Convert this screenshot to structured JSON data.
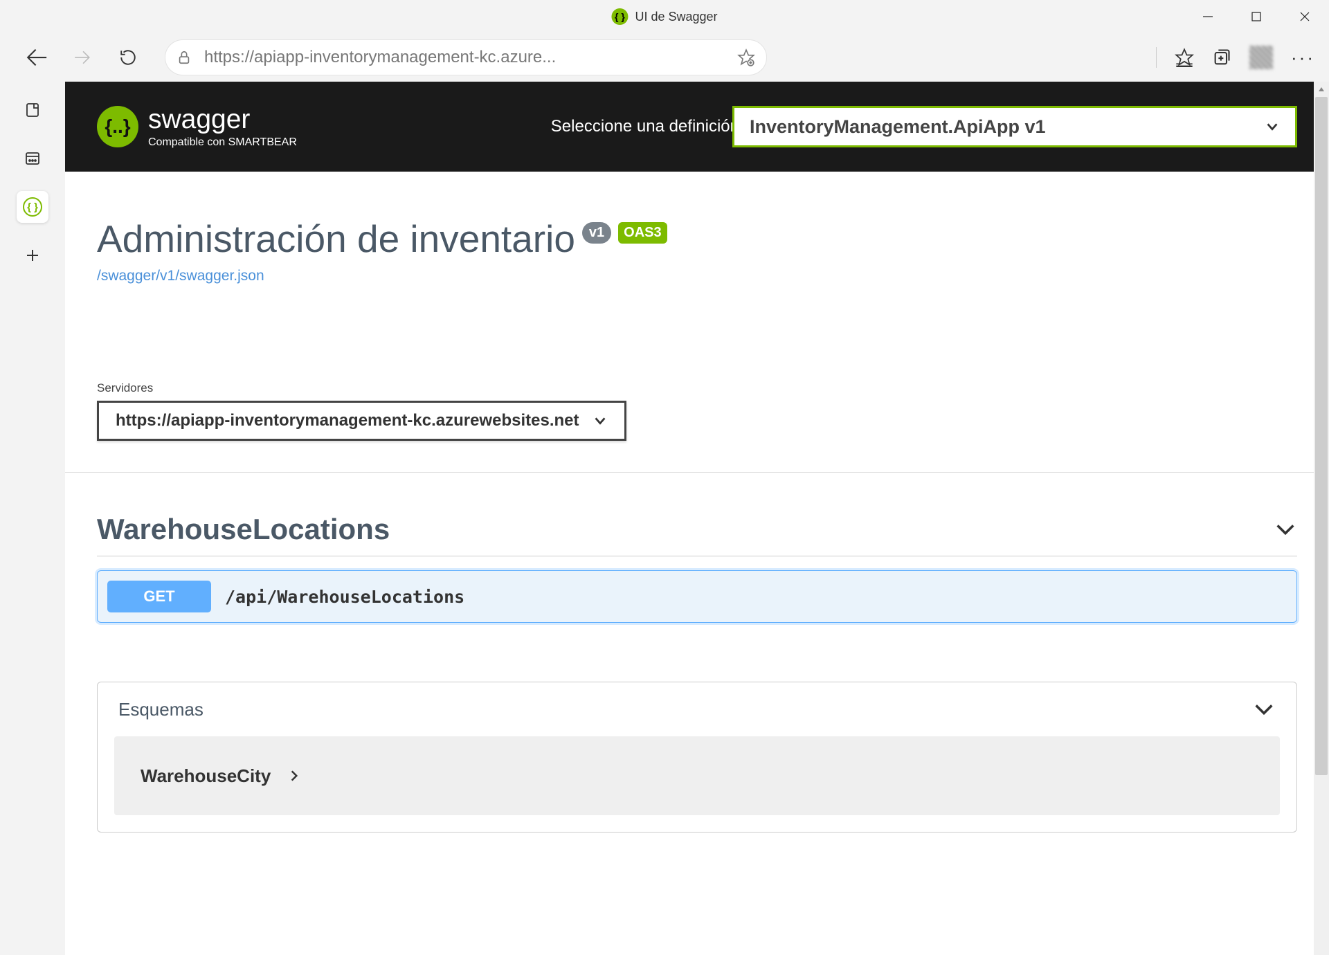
{
  "window": {
    "title": "UI de Swagger"
  },
  "browser": {
    "url": "https://apiapp-inventorymanagement-kc.azure..."
  },
  "topbar": {
    "logo_text": "swagger",
    "logo_subtext": "Compatible con SMARTBEAR",
    "definition_label": "Seleccione una definición",
    "definition_selected": "InventoryManagement.ApiApp v1"
  },
  "header": {
    "title": "Administración de inventario",
    "version_badge": "v1",
    "oas_badge": "OAS3",
    "spec_link": "/swagger/v1/swagger.json"
  },
  "servers": {
    "label": "Servidores",
    "selected": "https://apiapp-inventorymanagement-kc.azurewebsites.net"
  },
  "tags": [
    {
      "name": "WarehouseLocations"
    }
  ],
  "operations": [
    {
      "method": "GET",
      "path": "/api/WarehouseLocations"
    }
  ],
  "schemas": {
    "label": "Esquemas",
    "items": [
      "WarehouseCity"
    ]
  }
}
